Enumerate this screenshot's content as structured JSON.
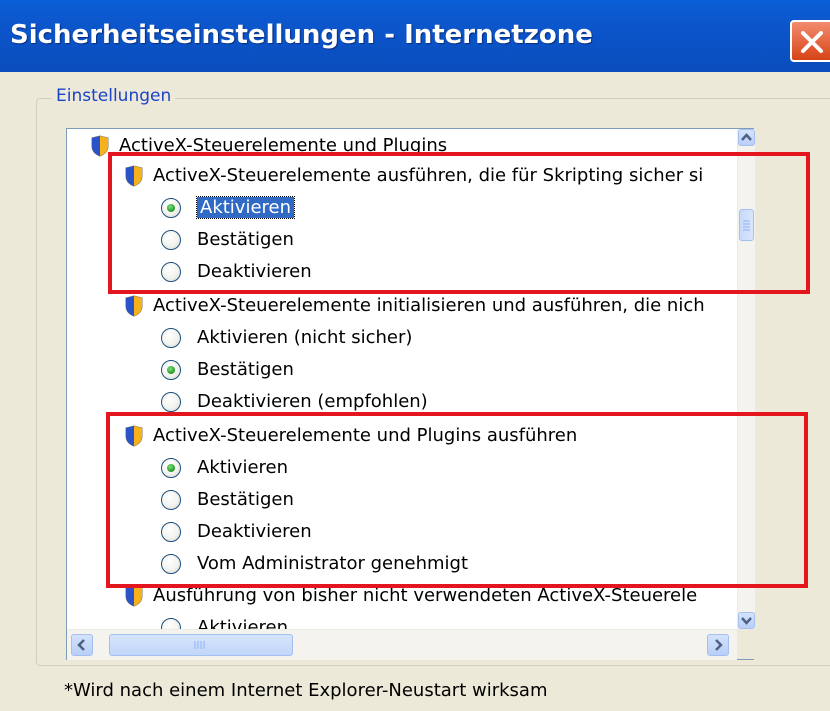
{
  "window": {
    "title": "Sicherheitseinstellungen - Internetzone"
  },
  "group": {
    "label": "Einstellungen"
  },
  "settings_list": {
    "category": "ActiveX-Steuerelemente und Plugins",
    "items": [
      {
        "label": "ActiveX-Steuerelemente ausführen, die für Skripting sicher si",
        "options": [
          {
            "label": "Aktivieren",
            "checked": true,
            "focused": true
          },
          {
            "label": "Bestätigen",
            "checked": false
          },
          {
            "label": "Deaktivieren",
            "checked": false
          }
        ]
      },
      {
        "label": "ActiveX-Steuerelemente initialisieren und ausführen, die nich",
        "options": [
          {
            "label": "Aktivieren (nicht sicher)",
            "checked": false
          },
          {
            "label": "Bestätigen",
            "checked": true
          },
          {
            "label": "Deaktivieren (empfohlen)",
            "checked": false
          }
        ]
      },
      {
        "label": "ActiveX-Steuerelemente und Plugins ausführen",
        "options": [
          {
            "label": "Aktivieren",
            "checked": true
          },
          {
            "label": "Bestätigen",
            "checked": false
          },
          {
            "label": "Deaktivieren",
            "checked": false
          },
          {
            "label": "Vom Administrator genehmigt",
            "checked": false
          }
        ]
      },
      {
        "label": "Ausführung von bisher nicht verwendeten ActiveX-Steuerele",
        "options": [
          {
            "label": "Aktivieren",
            "checked": false
          }
        ]
      }
    ]
  },
  "footnote": "*Wird nach einem Internet Explorer-Neustart wirksam",
  "colors": {
    "titlebar": "#0b55c9",
    "dialog_bg": "#ece9d8",
    "highlight_annotation": "#e2161c",
    "selection": "#316ac5"
  },
  "icons": {
    "category": "security-shield-icon",
    "setting": "security-shield-icon",
    "close": "close-icon"
  }
}
